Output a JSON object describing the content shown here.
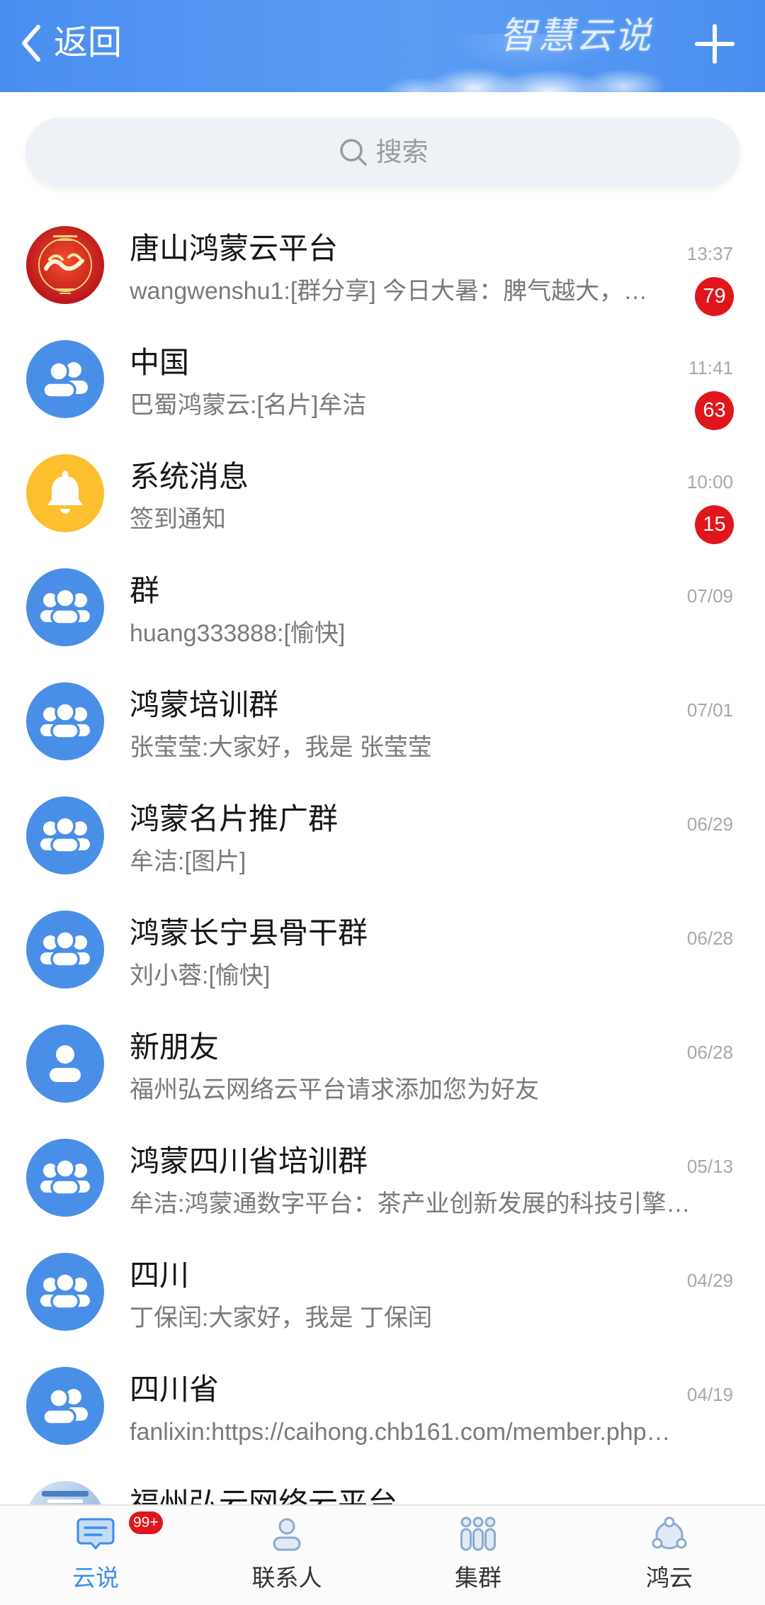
{
  "header": {
    "back_icon": "chevron-left-icon",
    "back_label": "返回",
    "decor_text": "智慧云说",
    "add_icon": "plus-icon"
  },
  "search": {
    "icon": "search-icon",
    "placeholder": "搜索"
  },
  "conversations": [
    {
      "title": "唐山鸿蒙云平台",
      "preview": "wangwenshu1:[群分享] 今日大暑：脾气越大，…",
      "time": "13:37",
      "unread": "79",
      "avatar_icon": "logo-image"
    },
    {
      "title": "中国",
      "preview": "巴蜀鸿蒙云:[名片]牟洁",
      "time": "11:41",
      "unread": "63",
      "avatar_icon": "two-person-icon"
    },
    {
      "title": "系统消息",
      "preview": "签到通知",
      "time": "10:00",
      "unread": "15",
      "avatar_icon": "bell-icon"
    },
    {
      "title": "群",
      "preview": "huang333888:[愉快]",
      "time": "07/09",
      "avatar_icon": "group-icon"
    },
    {
      "title": "鸿蒙培训群",
      "preview": "张莹莹:大家好，我是 张莹莹",
      "time": "07/01",
      "avatar_icon": "group-icon"
    },
    {
      "title": "鸿蒙名片推广群",
      "preview": "牟洁:[图片]",
      "time": "06/29",
      "avatar_icon": "group-icon"
    },
    {
      "title": "鸿蒙长宁县骨干群",
      "preview": "刘小蓉:[愉快]",
      "time": "06/28",
      "avatar_icon": "group-icon"
    },
    {
      "title": "新朋友",
      "preview": "福州弘云网络云平台请求添加您为好友",
      "time": "06/28",
      "avatar_icon": "person-icon"
    },
    {
      "title": "鸿蒙四川省培训群",
      "preview": "牟洁:鸿蒙通数字平台：茶产业创新发展的科技引擎…",
      "time": "05/13",
      "avatar_icon": "group-icon"
    },
    {
      "title": "四川",
      "preview": "丁保闰:大家好，我是 丁保闰",
      "time": "04/29",
      "avatar_icon": "group-icon"
    },
    {
      "title": "四川省",
      "preview": "fanlixin:https://caihong.chb161.com/member.php…",
      "time": "04/19",
      "avatar_icon": "two-person-icon"
    },
    {
      "title": "福州弘云网络云平台",
      "avatar_icon": "photo-image"
    }
  ],
  "tabbar": {
    "tabs": [
      {
        "label": "云说",
        "icon": "chat-icon",
        "active": true,
        "badge": "99+"
      },
      {
        "label": "联系人",
        "icon": "contacts-icon",
        "active": false
      },
      {
        "label": "集群",
        "icon": "cluster-icon",
        "active": false
      },
      {
        "label": "鸿云",
        "icon": "network-icon",
        "active": false
      }
    ]
  },
  "colors": {
    "header_blue": "#4a8ef0",
    "avatar_blue": "#4a8fe7",
    "bell_yellow": "#fcc02e",
    "badge_red": "#e0161c",
    "active_tab": "#3d8ee8",
    "active_tab_fill": "#c4dbf8",
    "inactive_icon": "#8eaace",
    "inactive_icon_fill": "#e1eaf6"
  }
}
